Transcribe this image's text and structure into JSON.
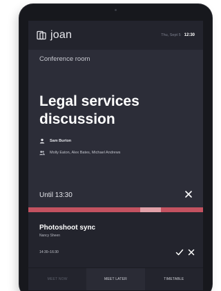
{
  "header": {
    "brand": "joan",
    "date": "Thu, Sept 5",
    "time": "12:30"
  },
  "room": {
    "name": "Conference room"
  },
  "current_meeting": {
    "title": "Legal services discussion",
    "organizer": "Sam Burton",
    "attendees": "Molly Eaton, Alex Bates, Michael Andrews",
    "until": "Until 13:30",
    "progress_position": 0.64,
    "progress_color": "#c35260",
    "progress_marker_color": "#e1a0a8"
  },
  "next_meeting": {
    "title": "Photoshoot sync",
    "organizer": "Nancy Sheen",
    "time": "14:30–16:30"
  },
  "actions": {
    "meet_now": "MEET NOW",
    "meet_later": "MEET LATER",
    "timetable": "TIMETABLE"
  }
}
